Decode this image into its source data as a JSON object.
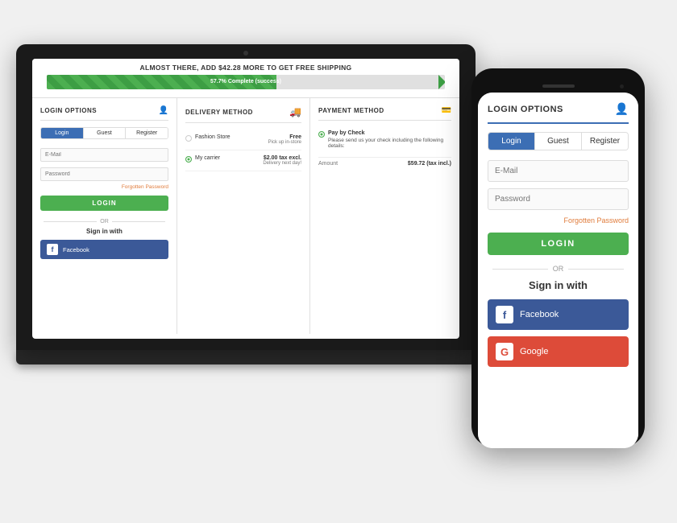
{
  "page": {
    "background_color": "#f0f0f0"
  },
  "laptop": {
    "banner": {
      "text": "ALMOST THERE, ADD $42.28 MORE TO GET FREE SHIPPING"
    },
    "progress_bar": {
      "percent": 57.7,
      "label": "57.7% Complete (success)"
    },
    "login_section": {
      "title": "LOGIN OPTIONS",
      "tabs": [
        "Login",
        "Guest",
        "Register"
      ],
      "active_tab": "Login",
      "email_placeholder": "E-Mail",
      "password_placeholder": "Password",
      "forgotten_password": "Forgotten Password",
      "login_button": "LOGIN",
      "or_text": "OR",
      "sign_in_with": "Sign in with",
      "facebook_button": "Facebook"
    },
    "delivery_section": {
      "title": "DELIVERY METHOD",
      "options": [
        {
          "name": "Fashion Store",
          "price": "Free",
          "sub": "Pick up in-store",
          "selected": false
        },
        {
          "name": "My carrier",
          "price": "$2.00 tax excl.",
          "sub": "Delivery next day!",
          "selected": true
        }
      ]
    },
    "payment_section": {
      "title": "PAYMENT METHOD",
      "options": [
        {
          "name": "Pay by Check",
          "desc": "Please send us your check including the following details:"
        }
      ],
      "amount_label": "Amount",
      "amount_value": "$59.72 (tax incl.)"
    }
  },
  "phone": {
    "section_title": "LOGIN OPTIONS",
    "tabs": [
      "Login",
      "Guest",
      "Register"
    ],
    "active_tab": "Login",
    "email_placeholder": "E-Mail",
    "password_placeholder": "Password",
    "forgotten_password": "Forgotten Password",
    "login_button": "LOGIN",
    "or_text": "OR",
    "sign_in_with": "Sign in with",
    "facebook_button": "Facebook",
    "google_button": "Google"
  }
}
